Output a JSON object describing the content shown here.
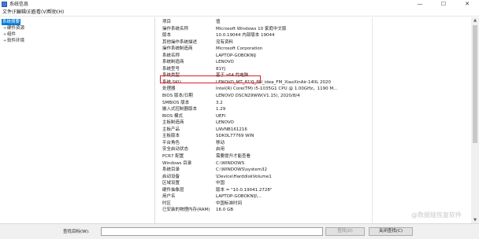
{
  "window": {
    "title": "系统信息",
    "minimize": "—",
    "maximize": "☐",
    "close": "✕"
  },
  "menu": [
    "文件(F)",
    "编辑(E)",
    "查看(V)",
    "帮助(H)"
  ],
  "tree": {
    "root": "系统摘要",
    "children": [
      {
        "label": "硬件资源",
        "expander": "+"
      },
      {
        "label": "组件",
        "expander": "+"
      },
      {
        "label": "软件环境",
        "expander": "+"
      }
    ]
  },
  "details": {
    "header": {
      "item": "项目",
      "value": "值"
    },
    "rows": [
      {
        "item": "操作系统名称",
        "value": "Microsoft Windows 10 家庭中文版"
      },
      {
        "item": "版本",
        "value": "10.0.19044 内部版本 19044"
      },
      {
        "item": "其他操作系统描述",
        "value": "没有资料"
      },
      {
        "item": "操作系统制造商",
        "value": "Microsoft Corporation"
      },
      {
        "item": "系统名称",
        "value": "LAPTOP-GOBOKNIJ"
      },
      {
        "item": "系统制造商",
        "value": "LENOVO"
      },
      {
        "item": "系统型号",
        "value": "81YJ"
      },
      {
        "item": "系统类型",
        "value": "基于 x64 的电脑"
      },
      {
        "item": "系统 SKU",
        "value": "LENOVO_MT_81YJ_BU_idea_FM_XiaoXinAir-14IIL 2020"
      },
      {
        "item": "处理器",
        "value": "Intel(R) Core(TM) i5-1035G1 CPU @ 1.00GHz，1190 M..."
      },
      {
        "item": "BIOS 版本/日期",
        "value": "LENOVO DSCN29WW(V1.15), 2020/8/4"
      },
      {
        "item": "SMBIOS 版本",
        "value": "3.2"
      },
      {
        "item": "嵌入式控制器版本",
        "value": "1.29"
      },
      {
        "item": "BIOS 模式",
        "value": "UEFI"
      },
      {
        "item": "主板制造商",
        "value": "LENOVO"
      },
      {
        "item": "主板产品",
        "value": "LNVNB161216"
      },
      {
        "item": "主板版本",
        "value": "SDK0L77769 WIN"
      },
      {
        "item": "平台角色",
        "value": "移动"
      },
      {
        "item": "安全启动状态",
        "value": "启用"
      },
      {
        "item": "PCR7 配置",
        "value": "需要提升才能查看"
      },
      {
        "item": "Windows 目录",
        "value": "C:\\WINDOWS"
      },
      {
        "item": "系统目录",
        "value": "C:\\WINDOWS\\system32"
      },
      {
        "item": "启动设备",
        "value": "\\Device\\HarddiskVolume1"
      },
      {
        "item": "区域设置",
        "value": "中国"
      },
      {
        "item": "硬件抽象层",
        "value": "版本 = \"10.0.19041.2728\""
      },
      {
        "item": "用户名",
        "value": "LAPTOP-GOBOKNIJ\\..."
      },
      {
        "item": "时区",
        "value": "中国标准时间"
      },
      {
        "item": "已安装的物理内存(RAM)",
        "value": "16.0 GB"
      }
    ]
  },
  "scrollbar": {
    "up": "▲",
    "down": "▼"
  },
  "find": {
    "label": "查找目标(W):",
    "value": "",
    "find_button": "查找(D)",
    "close_find_button": "关闭查找(C)"
  },
  "watermark": "@数据蛙恢复软件"
}
